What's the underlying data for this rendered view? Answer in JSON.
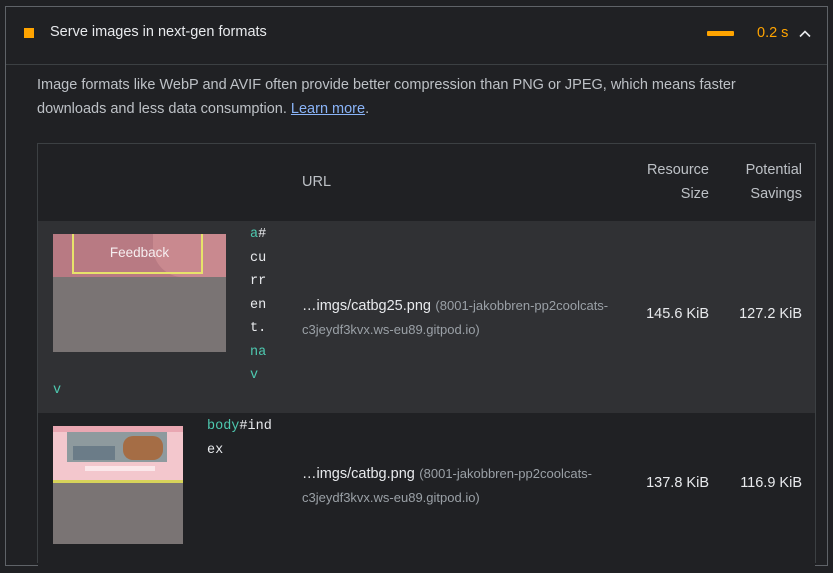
{
  "audit": {
    "title": "Serve images in next-gen formats",
    "score_value": "0.2 s",
    "description_text": "Image formats like WebP and AVIF often provide better compression than PNG or JPEG, which means faster downloads and less data consumption.",
    "learn_more": "Learn more",
    "period": "."
  },
  "table": {
    "headers": {
      "url": "URL",
      "resource_size_1": "Resource",
      "resource_size_2": "Size",
      "savings_1": "Potential",
      "savings_2": "Savings"
    },
    "rows": [
      {
        "thumb_text": "Feedback",
        "selector_tag": "a",
        "selector_hash": "#current.",
        "selector_class": "nav",
        "url_path": "…imgs/catbg25.png",
        "url_host": "(8001-jakobbren-pp2coolcats-c3jeydf3kvx.ws-eu89.gitpod.io)",
        "resource_size": "145.6 KiB",
        "potential_savings": "127.2 KiB"
      },
      {
        "selector_tag": "body",
        "selector_id": "#index",
        "url_path": "…imgs/catbg.png",
        "url_host": "(8001-jakobbren-pp2coolcats-c3jeydf3kvx.ws-eu89.gitpod.io)",
        "resource_size": "137.8 KiB",
        "potential_savings": "116.9 KiB"
      }
    ]
  },
  "colors": {
    "warning": "#ffa400",
    "link": "#8ab4f8",
    "selector_tag": "#4ec9b0"
  },
  "icons": [
    "warning-square-icon",
    "chevron-up-icon"
  ]
}
